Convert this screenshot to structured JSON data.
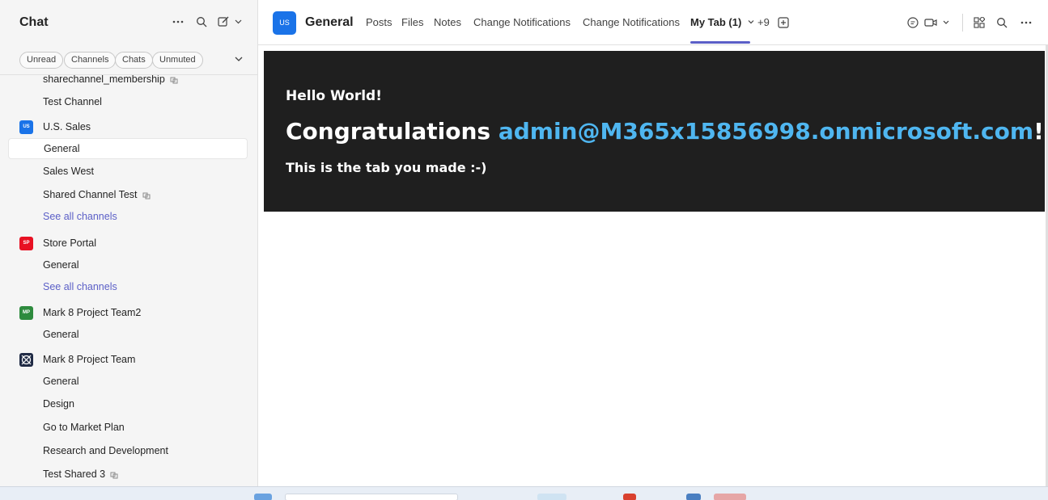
{
  "left": {
    "title": "Chat",
    "filters": [
      "Unread",
      "Channels",
      "Chats",
      "Unmuted"
    ]
  },
  "list": [
    {
      "type": "channel",
      "label": "sharechannel_membership",
      "shared": true
    },
    {
      "type": "channel",
      "label": "Test Channel",
      "shared": false
    },
    {
      "type": "team",
      "label": "U.S. Sales",
      "avatar_text": "US",
      "avatar_color": "#1a73e8"
    },
    {
      "type": "channel",
      "label": "General",
      "shared": false,
      "selected": true
    },
    {
      "type": "channel",
      "label": "Sales West",
      "shared": false
    },
    {
      "type": "channel",
      "label": "Shared Channel Test",
      "shared": true
    },
    {
      "type": "link",
      "label": "See all channels"
    },
    {
      "type": "team",
      "label": "Store Portal",
      "avatar_text": "SP",
      "avatar_color": "#e81123"
    },
    {
      "type": "channel",
      "label": "General",
      "shared": false
    },
    {
      "type": "link",
      "label": "See all channels"
    },
    {
      "type": "team",
      "label": "Mark 8 Project Team2",
      "avatar_text": "MP",
      "avatar_color": "#2e8b3e"
    },
    {
      "type": "channel",
      "label": "General",
      "shared": false
    },
    {
      "type": "team",
      "label": "Mark 8 Project Team",
      "avatar_text": "",
      "avatar_color": "#1f2a44"
    },
    {
      "type": "channel",
      "label": "General",
      "shared": false
    },
    {
      "type": "channel",
      "label": "Design",
      "shared": false
    },
    {
      "type": "channel",
      "label": "Go to Market Plan",
      "shared": false
    },
    {
      "type": "channel",
      "label": "Research and Development",
      "shared": false
    },
    {
      "type": "channel",
      "label": "Test Shared 3",
      "shared": true
    }
  ],
  "header": {
    "team_avatar": "US",
    "channel": "General",
    "tabs": [
      "Posts",
      "Files",
      "Notes",
      "Change Notifications",
      "Change Notifications",
      "My Tab (1)"
    ],
    "more_tabs": "+9"
  },
  "content": {
    "hello": "Hello World!",
    "congrats_prefix": "Congratulations ",
    "email": "admin@M365x15856998.onmicrosoft.com",
    "congrats_suffix": "!",
    "made": "This is the tab you made :-)"
  },
  "colors": {
    "accent": "#5b5fc7",
    "panel_bg": "#1f1f1f",
    "email": "#4fb6f0"
  }
}
